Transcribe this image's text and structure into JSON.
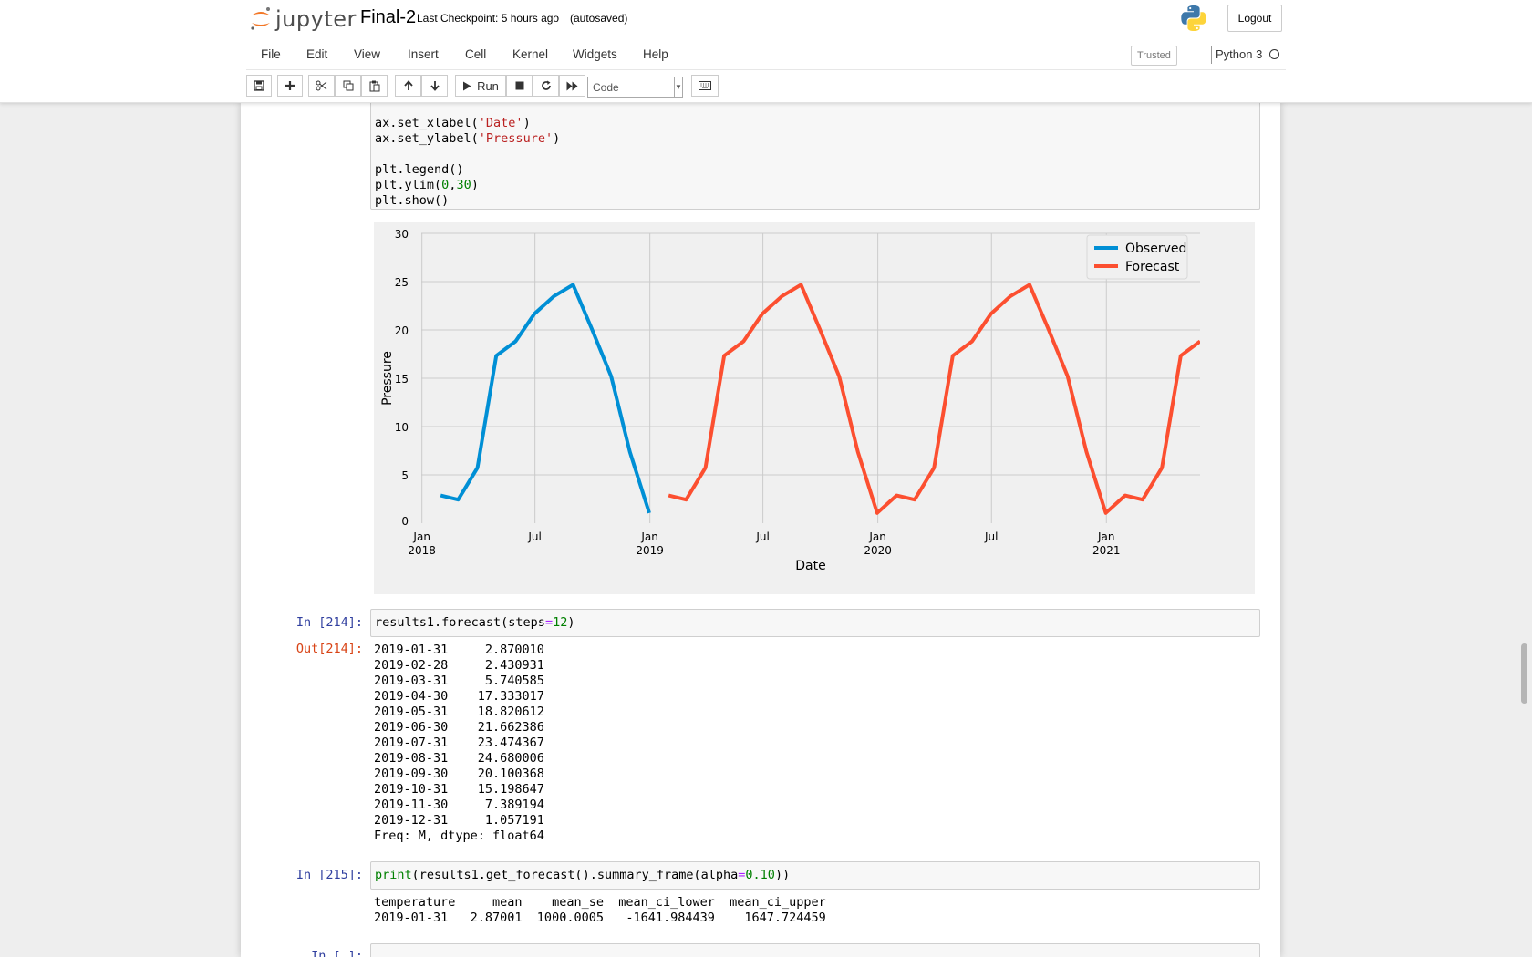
{
  "header": {
    "logo_text": "jupyter",
    "notebook_title": "Final-2",
    "checkpoint": "Last Checkpoint: 5 hours ago",
    "autosaved": "(autosaved)",
    "logout_label": "Logout"
  },
  "menu": [
    "File",
    "Edit",
    "View",
    "Insert",
    "Cell",
    "Kernel",
    "Widgets",
    "Help"
  ],
  "status": {
    "trusted": "Trusted",
    "kernel": "Python 3"
  },
  "toolbar": {
    "run_label": "Run",
    "cell_type": "Code"
  },
  "cells": {
    "code1_lines": [
      "ax.set_xlabel('Date')",
      "ax.set_ylabel('Pressure')",
      "",
      "plt.legend()",
      "plt.ylim(0,30)",
      "plt.show()"
    ],
    "in214_prompt": "In [214]:",
    "in214_code": "results1.forecast(steps=12)",
    "out214_prompt": "Out[214]:",
    "out214_lines": [
      "2019-01-31     2.870010",
      "2019-02-28     2.430931",
      "2019-03-31     5.740585",
      "2019-04-30    17.333017",
      "2019-05-31    18.820612",
      "2019-06-30    21.662386",
      "2019-07-31    23.474367",
      "2019-08-31    24.680006",
      "2019-09-30    20.100368",
      "2019-10-31    15.198647",
      "2019-11-30     7.389194",
      "2019-12-31     1.057191",
      "Freq: M, dtype: float64"
    ],
    "in215_prompt": "In [215]:",
    "in215_code": "print(results1.get_forecast().summary_frame(alpha=0.10))",
    "out215_lines": [
      "temperature     mean    mean_se  mean_ci_lower  mean_ci_upper",
      "2019-01-31   2.87001  1000.0005   -1641.984439    1647.724459"
    ],
    "next_prompt": "In [ ]:"
  },
  "chart_data": {
    "type": "line",
    "xlabel": "Date",
    "ylabel": "Pressure",
    "ylim": [
      0,
      30
    ],
    "yticks": [
      0,
      5,
      10,
      15,
      20,
      25,
      30
    ],
    "xlim": [
      "2017-12-31",
      "2021-05-31"
    ],
    "xticks": [
      {
        "date": "2018-01-01",
        "label": "Jan",
        "year": "2018"
      },
      {
        "date": "2018-07-01",
        "label": "Jul",
        "year": ""
      },
      {
        "date": "2019-01-01",
        "label": "Jan",
        "year": "2019"
      },
      {
        "date": "2019-07-01",
        "label": "Jul",
        "year": ""
      },
      {
        "date": "2020-01-01",
        "label": "Jan",
        "year": "2020"
      },
      {
        "date": "2020-07-01",
        "label": "Jul",
        "year": ""
      },
      {
        "date": "2021-01-01",
        "label": "Jan",
        "year": "2021"
      }
    ],
    "grid": true,
    "legend_position": "top-right",
    "series": [
      {
        "name": "Observed",
        "color": "#008fd5",
        "x": [
          "2018-01-31",
          "2018-02-28",
          "2018-03-31",
          "2018-04-30",
          "2018-05-31",
          "2018-06-30",
          "2018-07-31",
          "2018-08-31",
          "2018-09-30",
          "2018-10-31",
          "2018-11-30",
          "2018-12-31"
        ],
        "values": [
          2.87,
          2.43,
          5.74,
          17.33,
          18.82,
          21.66,
          23.47,
          24.68,
          20.1,
          15.2,
          7.39,
          1.06
        ]
      },
      {
        "name": "Forecast",
        "color": "#fc4f30",
        "x": [
          "2019-01-31",
          "2019-02-28",
          "2019-03-31",
          "2019-04-30",
          "2019-05-31",
          "2019-06-30",
          "2019-07-31",
          "2019-08-31",
          "2019-09-30",
          "2019-10-31",
          "2019-11-30",
          "2019-12-31",
          "2020-01-31",
          "2020-02-29",
          "2020-03-31",
          "2020-04-30",
          "2020-05-31",
          "2020-06-30",
          "2020-07-31",
          "2020-08-31",
          "2020-09-30",
          "2020-10-31",
          "2020-11-30",
          "2020-12-31",
          "2021-01-31",
          "2021-02-28",
          "2021-03-31",
          "2021-04-30",
          "2021-05-31"
        ],
        "values": [
          2.87,
          2.43,
          5.74,
          17.33,
          18.82,
          21.66,
          23.47,
          24.68,
          20.1,
          15.2,
          7.39,
          1.06,
          2.87,
          2.43,
          5.74,
          17.33,
          18.82,
          21.66,
          23.47,
          24.68,
          20.1,
          15.2,
          7.39,
          1.06,
          2.87,
          2.43,
          5.74,
          17.33,
          18.82
        ]
      }
    ]
  }
}
